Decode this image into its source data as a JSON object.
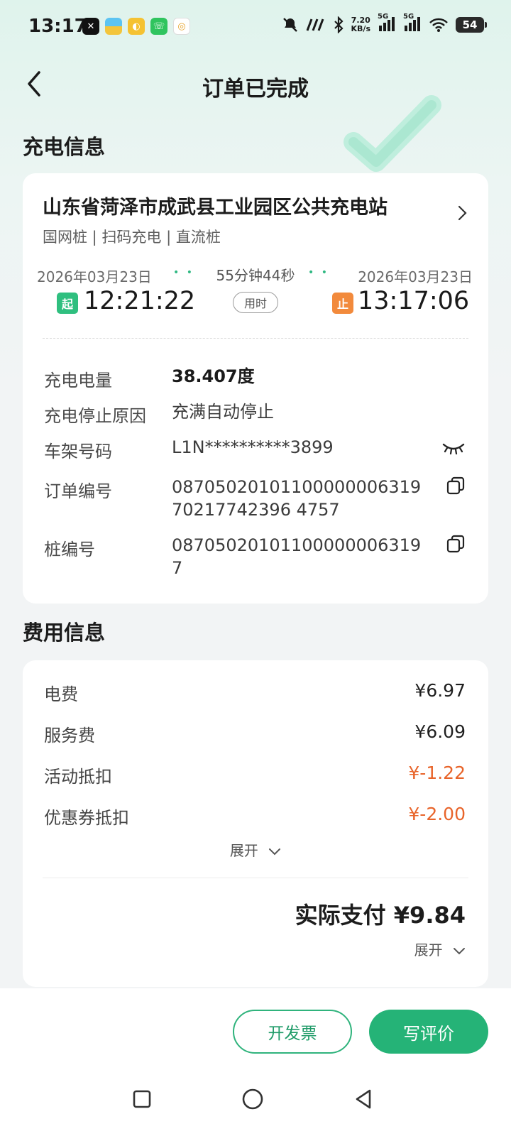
{
  "status_bar": {
    "time": "13:17",
    "speed_value": "7.20",
    "speed_unit": "KB/s",
    "net1": "5G",
    "net2": "5G",
    "battery": "54"
  },
  "header": {
    "title": "订单已完成"
  },
  "charge_section": {
    "title": "充电信息",
    "station_name": "山东省菏泽市成武县工业园区公共充电站",
    "station_tags": "国网桩 | 扫码充电 | 直流桩",
    "start_date": "2026年03月23日",
    "end_date": "2026年03月23日",
    "duration": "55分钟44秒",
    "start_badge": "起",
    "stop_badge": "止",
    "start_time": "12:21:22",
    "end_time": "13:17:06",
    "used_time_label": "用时",
    "rows": [
      {
        "label": "充电电量",
        "value": "38.407度"
      },
      {
        "label": "充电停止原因",
        "value": "充满自动停止"
      },
      {
        "label": "车架号码",
        "value": "L1N**********3899"
      },
      {
        "label": "订单编号",
        "value_line1": "08705020101100000006319",
        "value_line2": "70217742396 4757"
      },
      {
        "label": "桩编号",
        "value_line1": "08705020101100000006319",
        "value_line2": "7"
      }
    ]
  },
  "fee_section": {
    "title": "费用信息",
    "items": [
      {
        "label": "电费",
        "value": "¥6.97"
      },
      {
        "label": "服务费",
        "value": "¥6.09"
      },
      {
        "label": "活动抵扣",
        "value": "¥-1.22"
      },
      {
        "label": "优惠券抵扣",
        "value": "¥-2.00"
      }
    ],
    "expand_label": "展开",
    "total_label": "实际支付",
    "total_value": "¥9.84",
    "total_expand_label": "展开"
  },
  "actions": {
    "invoice_label": "开发票",
    "review_label": "写评价"
  },
  "colors": {
    "accent_green": "#25b377",
    "discount_orange": "#e8642a",
    "start_badge": "#2fbf7f",
    "stop_badge": "#f28a3c"
  }
}
